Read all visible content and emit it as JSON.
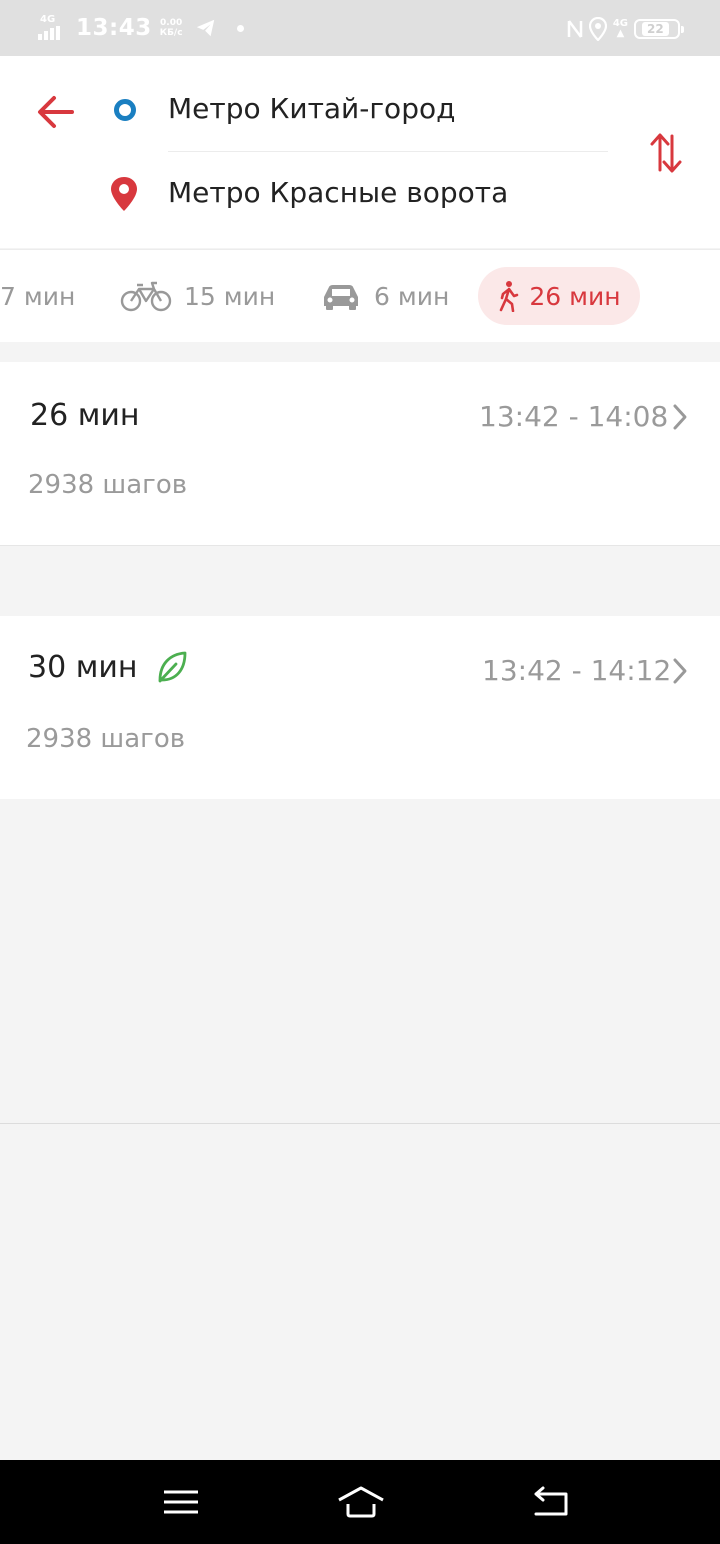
{
  "status_bar": {
    "network": "4G",
    "time": "13:43",
    "speed_value": "0.00",
    "speed_unit": "КБ/с",
    "network_right": "4G",
    "battery": "22"
  },
  "route": {
    "from": "Метро Китай-город",
    "to": "Метро Красные ворота"
  },
  "tabs": [
    {
      "id": "transit",
      "label": "7 мин",
      "active": false
    },
    {
      "id": "bike",
      "label": "15 мин",
      "active": false
    },
    {
      "id": "car",
      "label": "6 мин",
      "active": false
    },
    {
      "id": "walk",
      "label": "26 мин",
      "active": true
    }
  ],
  "results": [
    {
      "duration": "26 мин",
      "times": "13:42 - 14:08",
      "steps": "2938 шагов",
      "eco": false
    },
    {
      "duration": "30 мин",
      "times": "13:42 - 14:12",
      "steps": "2938 шагов",
      "eco": true
    }
  ],
  "colors": {
    "accent": "#d8383e",
    "active_tab_bg": "#fbe8e8",
    "from_marker": "#1a7fc1",
    "eco_icon": "#4caf50",
    "secondary_text": "#9a9a9a"
  },
  "icons": {
    "back": "arrow-left-icon",
    "swap": "swap-vertical-icon",
    "bike": "bicycle-icon",
    "car": "car-icon",
    "walk": "pedestrian-icon",
    "eco": "leaf-icon",
    "chevron": "chevron-right-icon"
  }
}
